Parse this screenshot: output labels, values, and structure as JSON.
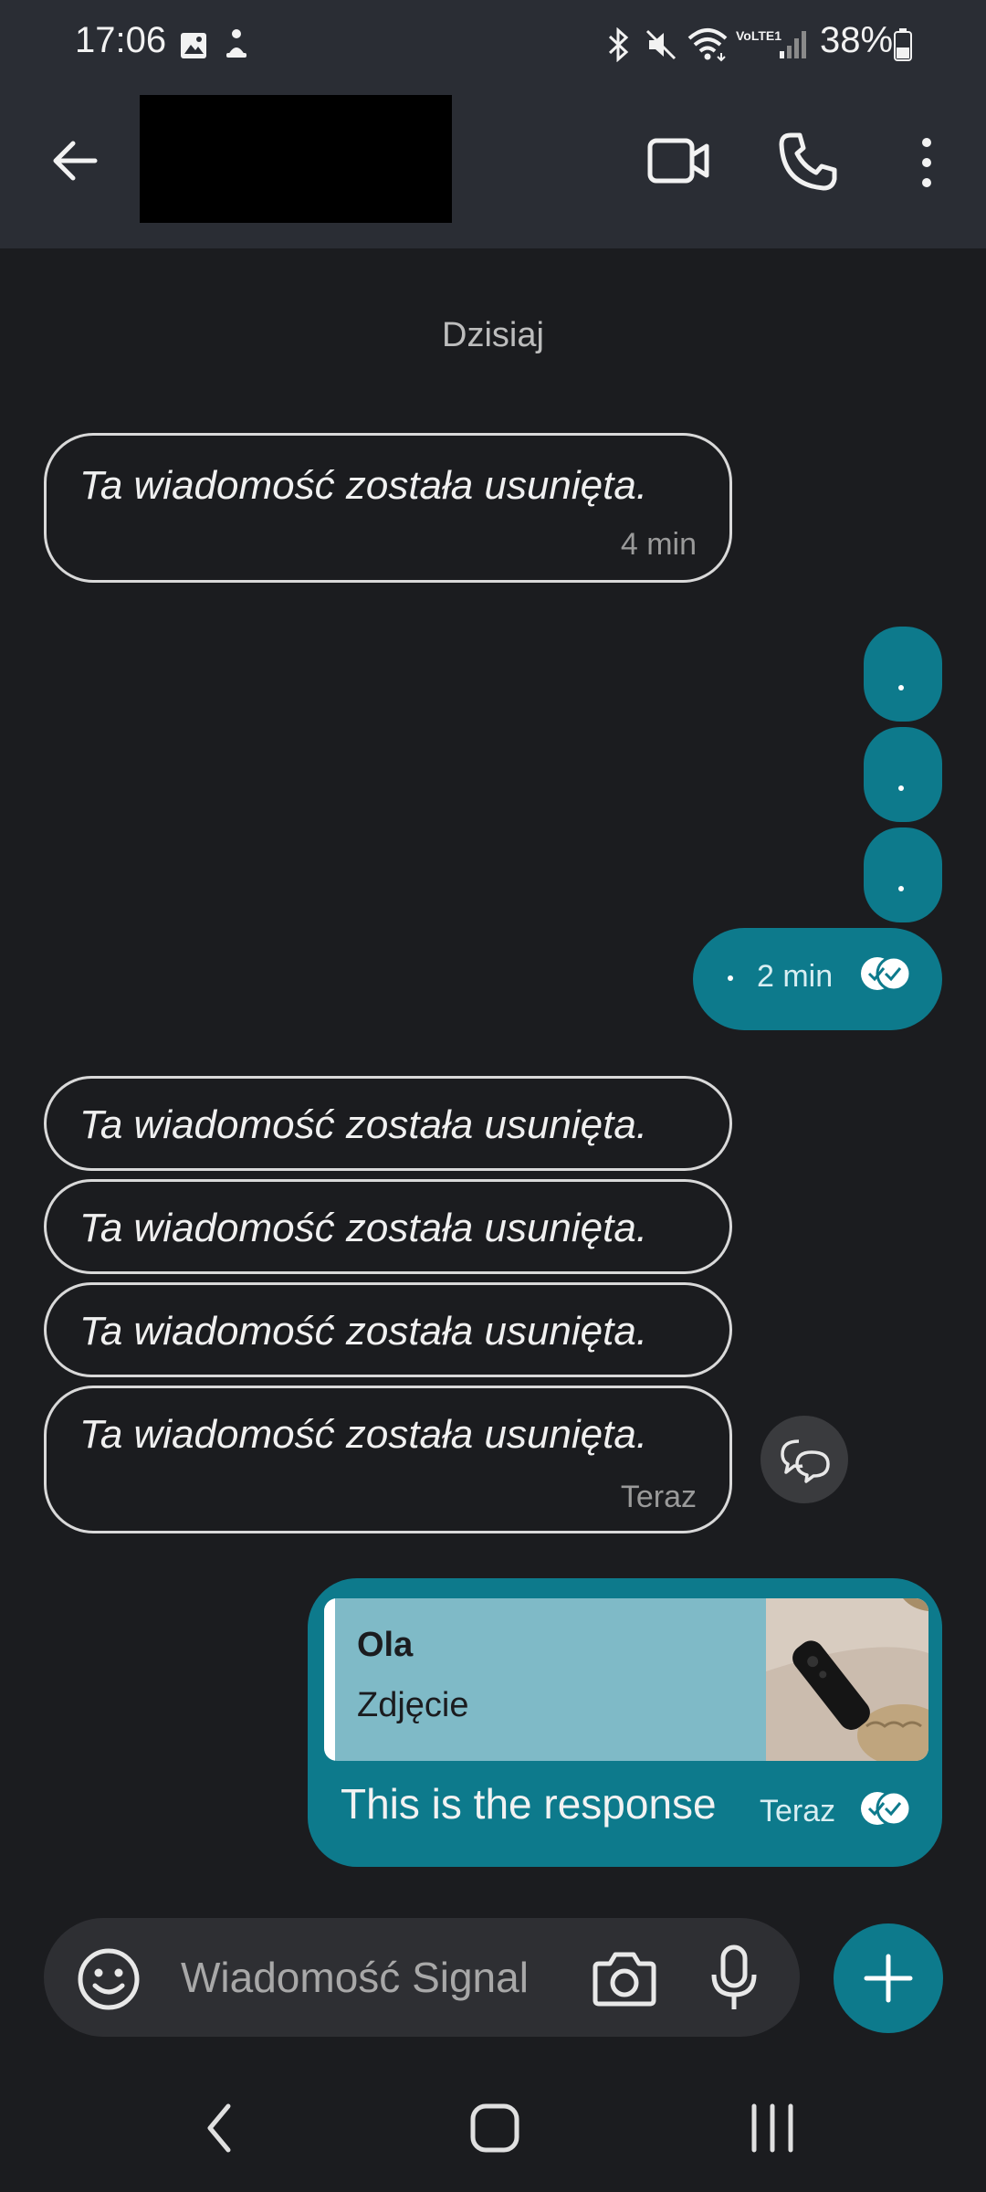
{
  "status_bar": {
    "time": "17:06",
    "battery": "38%",
    "icons": [
      "image-icon",
      "app-notification-icon",
      "bluetooth-icon",
      "mute-icon",
      "wifi-icon",
      "volte-icon",
      "signal-icon",
      "battery-icon"
    ],
    "volte_text": "VoLTE1"
  },
  "header": {
    "icons": [
      "back-arrow-icon",
      "video-call-icon",
      "phone-call-icon",
      "more-vert-icon"
    ]
  },
  "colors": {
    "background": "#1b1c1f",
    "header": "#2a2d34",
    "outgoing_bubble": "#0d7a8c",
    "quote_background": "#7fbac7"
  },
  "chat": {
    "day_label": "Dzisiaj",
    "deleted_text": "Ta wiadomość została usunięta.",
    "msg1_time": "4 min",
    "outgoing_dot": ".",
    "outgoing_time": "2 min",
    "last_incoming_time": "Teraz",
    "reply": {
      "quote_author": "Ola",
      "quote_type": "Zdjęcie",
      "text": "This is the response",
      "time": "Teraz"
    }
  },
  "composer": {
    "placeholder": "Wiadomość Signal",
    "icons": [
      "emoji-icon",
      "camera-icon",
      "microphone-icon",
      "plus-icon"
    ]
  },
  "nav_bar": {
    "icons": [
      "nav-back-icon",
      "nav-home-icon",
      "nav-recents-icon"
    ]
  }
}
